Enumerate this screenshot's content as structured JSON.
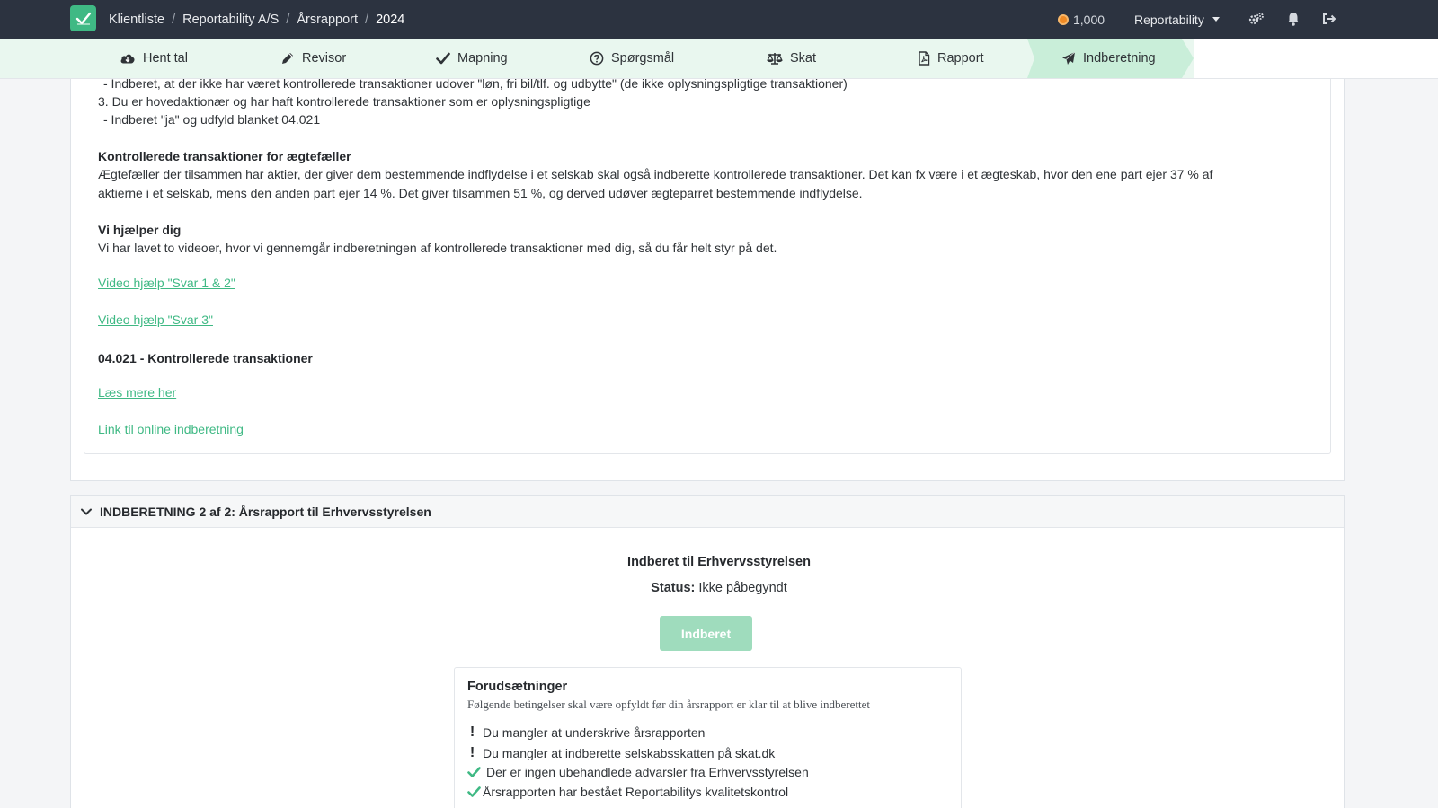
{
  "breadcrumb": [
    "Klientliste",
    "Reportability A/S",
    "Årsrapport",
    "2024"
  ],
  "topbar": {
    "coins": "1,000",
    "org": "Reportability"
  },
  "steps": [
    "Hent tal",
    "Revisor",
    "Mapning",
    "Spørgsmål",
    "Skat",
    "Rapport",
    "Indberetning"
  ],
  "content": {
    "line_cut": "- Indberet, at der ikke har været kontrollerede transaktioner udover \"løn, fri bil/tlf. og udbytte\" (de ikke oplysningspligtige transaktioner)",
    "point3": "3. Du er hovedaktionær og har haft kontrollerede transaktioner som er oplysningspligtige",
    "point3_sub": "- Indberet \"ja\" og udfyld blanket 04.021",
    "spouse_heading": "Kontrollerede transaktioner for ægtefæller",
    "spouse_text_1": "Ægtefæller der tilsammen har aktier, der giver dem bestemmende indflydelse i et selskab skal også indberette kontrollerede transaktioner. Det kan fx være i et ægteskab, hvor den ene part ejer 37 % af",
    "spouse_text_2": "aktierne i et selskab, mens den anden part ejer 14 %. Det giver tilsammen 51 %, og derved udøver ægteparret bestemmende indflydelse.",
    "help_heading": "Vi hjælper dig",
    "help_text": "Vi har lavet to videoer, hvor vi gennemgår indberetningen af kontrollerede transaktioner med dig, så du får helt styr på det.",
    "video1": "Video hjælp \"Svar 1 & 2\"",
    "video2": "Video hjælp \"Svar 3\"",
    "form_heading": "04.021 - Kontrollerede transaktioner",
    "read_more": "Læs mere her",
    "online_link": "Link til online indberetning"
  },
  "section2": {
    "title": "INDBERETNING 2 af 2: Årsrapport til Erhvervsstyrelsen",
    "subtitle": "Indberet til Erhvervsstyrelsen",
    "status_label": "Status:",
    "status_value": "Ikke påbegyndt",
    "button": "Indberet",
    "prereq_title": "Forudsætninger",
    "prereq_sub": "Følgende betingelser skal være opfyldt før din årsrapport er klar til at blive indberettet",
    "items": [
      {
        "ok": false,
        "text": "Du mangler at underskrive årsrapporten"
      },
      {
        "ok": false,
        "text": "Du mangler at indberette selskabsskatten på skat.dk"
      },
      {
        "ok": true,
        "text": "Der er ingen ubehandlede advarsler fra Erhvervsstyrelsen"
      },
      {
        "ok": true,
        "text": "Årsrapporten har bestået Reportabilitys kvalitetskontrol"
      }
    ]
  },
  "colors": {
    "topbar": "#2c3340",
    "accent": "#3fb984",
    "nav_bg": "#e9f7ef",
    "active_step": "#c9eed9"
  }
}
